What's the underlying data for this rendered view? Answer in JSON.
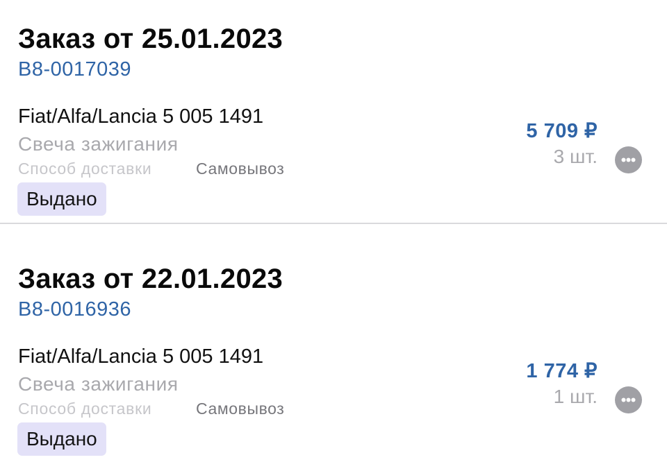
{
  "orders": [
    {
      "title": "Заказ от 25.01.2023",
      "number": "B8-0017039",
      "item_title": "Fiat/Alfa/Lancia 5 005 1491",
      "item_subtitle": "Свеча зажигания",
      "delivery_label": "Способ доставки",
      "delivery_value": "Самовывоз",
      "status": "Выдано",
      "price": "5 709 ₽",
      "quantity": "3 шт.",
      "more_icon": "ellipsis-circle-icon"
    },
    {
      "title": "Заказ от 22.01.2023",
      "number": "B8-0016936",
      "item_title": "Fiat/Alfa/Lancia 5 005 1491",
      "item_subtitle": "Свеча зажигания",
      "delivery_label": "Способ доставки",
      "delivery_value": "Самовывоз",
      "status": "Выдано",
      "price": "1 774 ₽",
      "quantity": "1 шт.",
      "more_icon": "ellipsis-circle-icon"
    }
  ],
  "colors": {
    "accent_blue": "#2f64a6",
    "status_badge_bg": "#e3e1f8",
    "more_button_bg": "#a0a0a5",
    "divider": "#d9d9dc"
  }
}
